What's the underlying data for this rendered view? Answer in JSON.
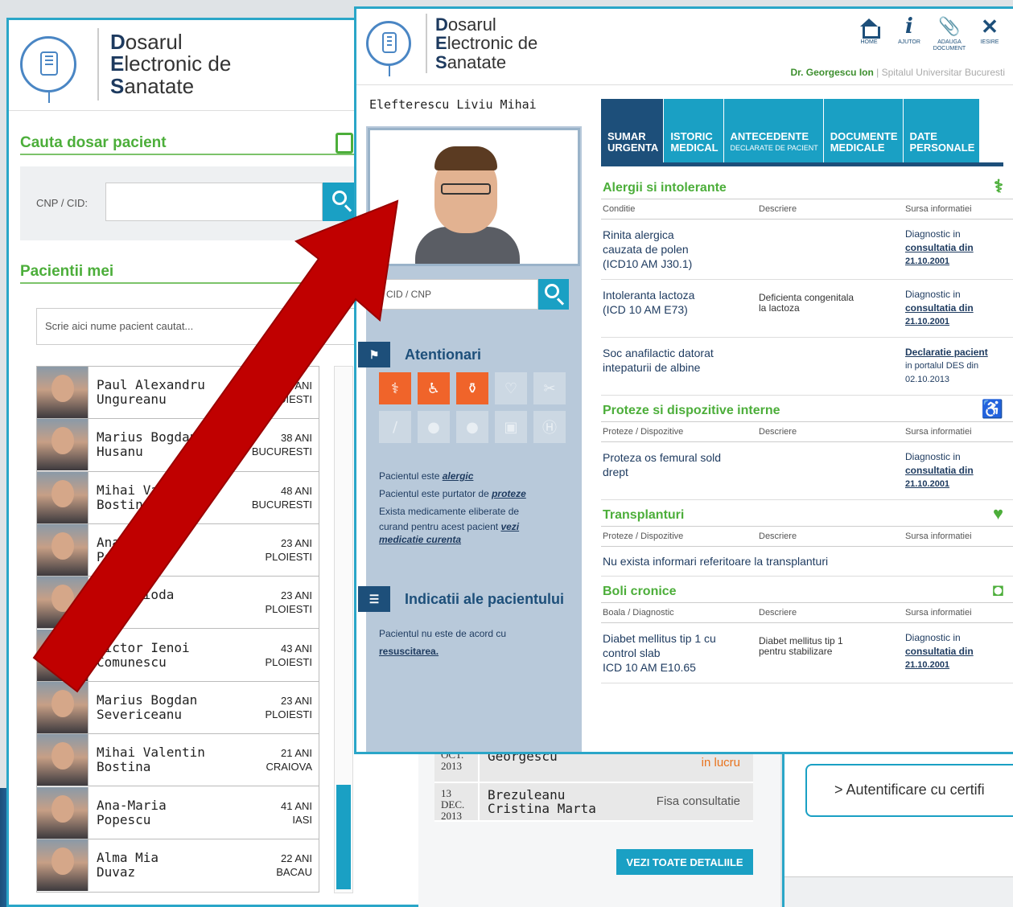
{
  "app": {
    "logo_lines": [
      {
        "initial": "D",
        "rest": "osarul"
      },
      {
        "initial": "E",
        "rest": "lectronic de"
      },
      {
        "initial": "S",
        "rest": "anatate"
      }
    ]
  },
  "back": {
    "search_title": "Cauta dosar pacient",
    "cnp_label": "CNP / CID:",
    "patients_title": "Pacientii mei",
    "name_search_placeholder": "Scrie aici nume pacient cautat...",
    "patients": [
      {
        "first": "Paul Alexandru",
        "last": "Ungureanu",
        "age": "ANI",
        "city": "PLOIESTI"
      },
      {
        "first": "Marius Bogdan",
        "last": "Husanu",
        "age": "38 ANI",
        "city": "BUCURESTI"
      },
      {
        "first": "Mihai Valentin",
        "last": "Bostina",
        "age": "48 ANI",
        "city": "BUCURESTI"
      },
      {
        "first": "Ana",
        "last": "Po",
        "age": "23 ANI",
        "city": "PLOIESTI"
      },
      {
        "first": "nora Dioda",
        "last": "escu",
        "age": "23 ANI",
        "city": "PLOIESTI"
      },
      {
        "first": "Victor Ienoi",
        "last": "Comunescu",
        "age": "43 ANI",
        "city": "PLOIESTI"
      },
      {
        "first": "Marius Bogdan",
        "last": "Severiceanu",
        "age": "23 ANI",
        "city": "PLOIESTI"
      },
      {
        "first": "Mihai Valentin",
        "last": "Bostina",
        "age": "21 ANI",
        "city": "CRAIOVA"
      },
      {
        "first": "Ana-Maria",
        "last": "Popescu",
        "age": "41 ANI",
        "city": "IASI"
      },
      {
        "first": "Alma Mia",
        "last": "Duvaz",
        "age": "22 ANI",
        "city": "BACAU"
      }
    ],
    "history": [
      {
        "date": [
          "OCT.",
          "2013"
        ],
        "name": [
          "Georgescu",
          ""
        ],
        "status": "in lucru",
        "orange": true
      },
      {
        "date": [
          "13",
          "DEC.",
          "2013"
        ],
        "name": [
          "Brezuleanu",
          "Cristina Marta"
        ],
        "status": "Fisa consultatie",
        "orange": false
      }
    ],
    "details_button": "VEZI TOATE DETALIILE",
    "auth_button": "> Autentificare cu certifi"
  },
  "front": {
    "toolbar": [
      {
        "icon": "home-icon",
        "label": [
          "HOME"
        ]
      },
      {
        "icon": "info-icon",
        "label": [
          "AJUTOR"
        ]
      },
      {
        "icon": "paperclip-icon",
        "label": [
          "ADAUGA",
          "DOCUMENT"
        ]
      },
      {
        "icon": "close-icon",
        "label": [
          "IESIRE"
        ]
      }
    ],
    "doctor_name": "Dr. Georgescu Ion",
    "doctor_hospital": " | Spitalul Universitar Bucuresti",
    "patient_name": "Elefterescu Liviu Mihai",
    "cid_placeholder": "CID / CNP",
    "warnings_title": "Atentionari",
    "warning_text": [
      {
        "pre": "Pacientul este ",
        "link": "alergic"
      },
      {
        "pre": "Pacientul este purtator de ",
        "link": "proteze"
      },
      {
        "pre": "Exista medicamente eliberate de",
        "link": ""
      },
      {
        "pre": "curand pentru acest pacient ",
        "link": "vezi"
      },
      {
        "pre": "",
        "link": "medicatie curenta"
      }
    ],
    "indications_title": "Indicatii ale pacientului",
    "indication_text": [
      "Pacientul nu este de acord cu",
      "resuscitarea."
    ],
    "tabs": [
      {
        "line1": "SUMAR",
        "line2": "URGENTA",
        "active": true
      },
      {
        "line1": "ISTORIC",
        "line2": "MEDICAL",
        "active": false
      },
      {
        "line1": "ANTECEDENTE",
        "line2": "DECLARATE DE PACIENT",
        "active": false
      },
      {
        "line1": "DOCUMENTE",
        "line2": "MEDICALE",
        "active": false
      },
      {
        "line1": "DATE",
        "line2": "PERSONALE",
        "active": false
      }
    ],
    "sections": [
      {
        "title": "Alergii si intolerante",
        "icon": "dna-icon",
        "headers": [
          "Conditie",
          "Descriere",
          "Sursa informatiei"
        ],
        "rows": [
          {
            "c1": [
              "Rinita alergica",
              "cauzata de polen",
              "(ICD10 AM J30.1)"
            ],
            "c2": [
              ""
            ],
            "src": [
              "Diagnostic in",
              "consultatia din",
              "21.10.2001"
            ]
          },
          {
            "c1": [
              "Intoleranta lactoza",
              "(ICD 10 AM E73)"
            ],
            "c2": [
              "Deficienta congenitala",
              "la lactoza"
            ],
            "src": [
              "Diagnostic in",
              "consultatia din",
              "21.10.2001"
            ]
          },
          {
            "c1": [
              "Soc anafilactic datorat",
              "intepaturii de albine"
            ],
            "c2": [
              ""
            ],
            "src": [
              "Declaratie pacient",
              "in portalul DES din",
              "02.10.2013"
            ]
          }
        ]
      },
      {
        "title": "Proteze si dispozitive interne",
        "icon": "wheelchair-icon",
        "headers": [
          "Proteze / Dispozitive",
          "Descriere",
          "Sursa informatiei"
        ],
        "rows": [
          {
            "c1": [
              "Proteza os femural sold",
              "drept"
            ],
            "c2": [
              ""
            ],
            "src": [
              "Diagnostic in",
              "consultatia din",
              "21.10.2001"
            ]
          }
        ]
      },
      {
        "title": "Transplanturi",
        "icon": "heart-plus-icon",
        "headers": [
          "Proteze / Dispozitive",
          "Descriere",
          "Sursa informatiei"
        ],
        "empty": "Nu exista informari referitoare la transplanturi",
        "rows": []
      },
      {
        "title": "Boli cronice",
        "icon": "pill-icon",
        "headers": [
          "Boala / Diagnostic",
          "Descriere",
          "Sursa informatiei"
        ],
        "rows": [
          {
            "c1": [
              "Diabet mellitus tip 1 cu",
              "control slab",
              "ICD 10 AM E10.65"
            ],
            "c2": [
              "Diabet mellitus tip 1",
              "pentru stabilizare"
            ],
            "src": [
              "Diagnostic in",
              "consultatia din",
              "21.10.2001"
            ]
          }
        ]
      }
    ]
  },
  "colors": {
    "accent": "#1aa0c4",
    "navy": "#1d4f7a",
    "green": "#4cae3a",
    "alert": "#f0642a",
    "arrow": "#c00000"
  }
}
